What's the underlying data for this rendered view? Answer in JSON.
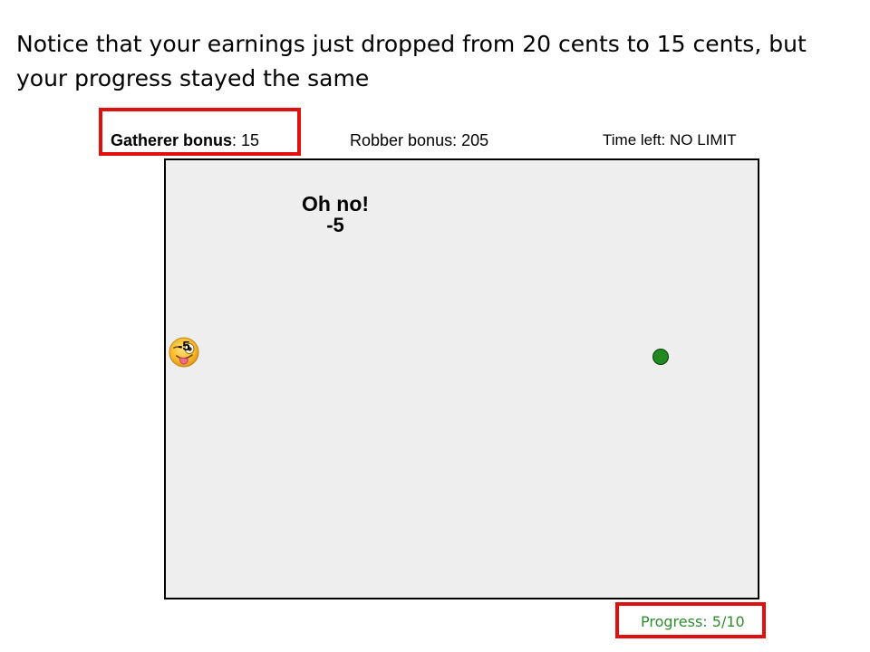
{
  "instruction": "Notice that your earnings just dropped from 20 cents to 15 cents, but your progress stayed the same",
  "stats": {
    "gatherer_label": "Gatherer bonus",
    "gatherer_value": ": 15",
    "robber_text": "Robber bonus: 205",
    "time_text": "Time left: NO LIMIT"
  },
  "feedback": {
    "title": "Oh no!",
    "delta": "-5"
  },
  "player": {
    "icon": "tongue-out-emoji",
    "value": "-5"
  },
  "resource": {
    "icon": "green-dot",
    "color": "#1f8a1f"
  },
  "progress": {
    "text": "Progress: 5/10",
    "current": 5,
    "total": 10,
    "color": "#2e8b2e"
  },
  "highlight_color": "#e01010"
}
